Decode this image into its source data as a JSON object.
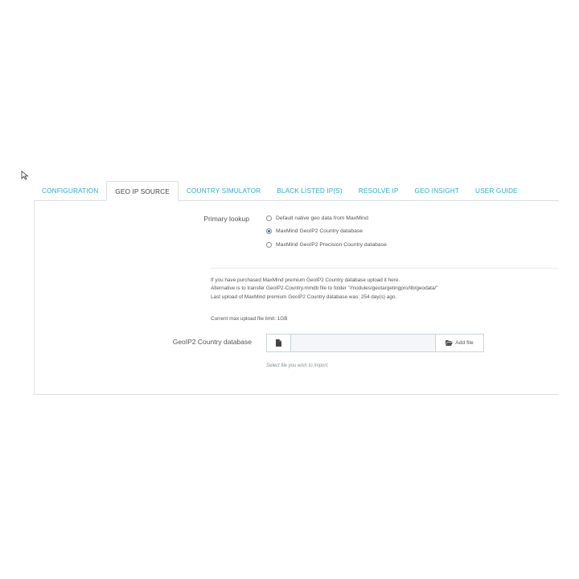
{
  "tabs": [
    {
      "label": "CONFIGURATION",
      "active": false
    },
    {
      "label": "GEO IP SOURCE",
      "active": true
    },
    {
      "label": "COUNTRY SIMULATOR",
      "active": false
    },
    {
      "label": "BLACK LISTED IP(S)",
      "active": false
    },
    {
      "label": "RESOLVE IP",
      "active": false
    },
    {
      "label": "GEO INSIGHT",
      "active": false
    },
    {
      "label": "USER GUIDE",
      "active": false
    }
  ],
  "primary_lookup": {
    "label": "Primary lookup",
    "options": [
      {
        "label": "Default native geo data from MaxMind",
        "checked": false
      },
      {
        "label": "MaxMind GeoIP2 Country database",
        "checked": true
      },
      {
        "label": "MaxMind GeoIP2 Precision Country database",
        "checked": false
      }
    ]
  },
  "info": {
    "line1": "If you have purchased MaxMind premium GeoIP2 Country database upload it here.",
    "line2": "Alternative is to transfer GeoIP2-Country.mmdb file to folder \"/modules/geotargetingpro/lib/geodata/\"",
    "line3": "Last upload of MaxMind premium GeoIP2 Country database was: 254 day(s) ago.",
    "limit": "Current max upload file limit: 1GB"
  },
  "upload": {
    "label": "GeoIP2 Country database",
    "value": "",
    "add_label": "Add file",
    "help": "Select file you wish to import."
  },
  "colors": {
    "tab_link": "#2eacce",
    "radio_selected": "#3d6fb0",
    "border": "#dcdfe3"
  },
  "icons": [
    "cursor-icon",
    "file-icon",
    "folder-open-icon"
  ]
}
